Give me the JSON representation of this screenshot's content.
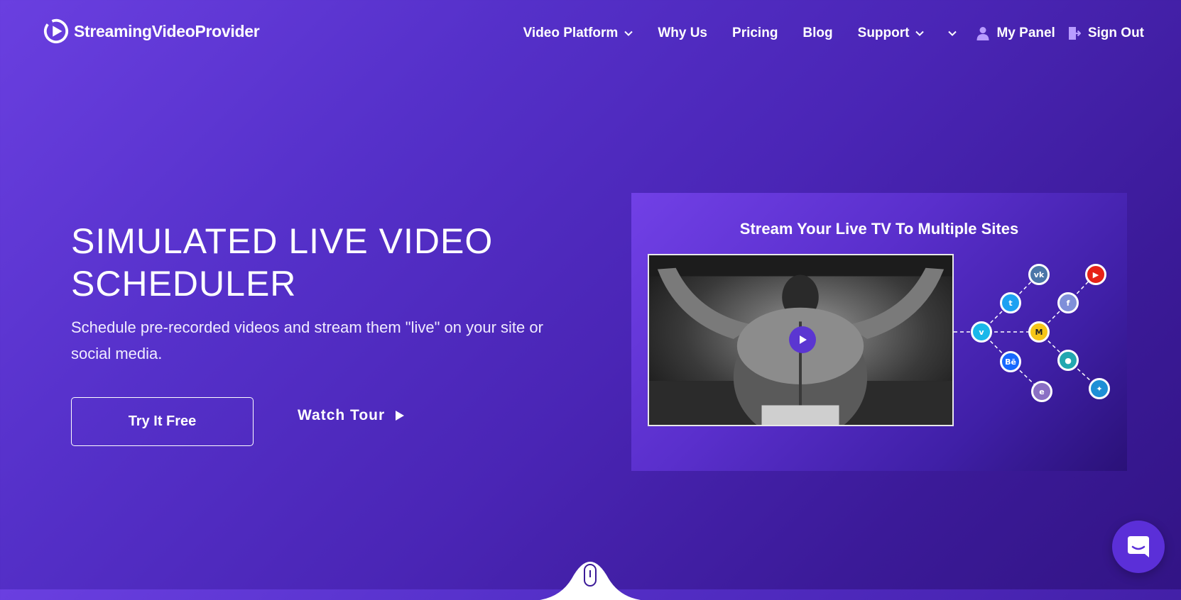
{
  "header": {
    "logo_text": "StreamingVideoProvider",
    "nav": {
      "video_platform": "Video Platform",
      "why_us": "Why Us",
      "pricing": "Pricing",
      "blog": "Blog",
      "support": "Support",
      "my_panel": "My Panel",
      "sign_out": "Sign Out"
    }
  },
  "hero": {
    "title": "SIMULATED LIVE VIDEO SCHEDULER",
    "subtitle": "Schedule pre-recorded videos and stream them \"live\" on your site or social media.",
    "try_button": "Try It Free",
    "watch_tour": "Watch Tour"
  },
  "promo": {
    "title": "Stream Your Live TV To Multiple Sites",
    "network_icons": [
      "vimeo-icon",
      "twitter-icon",
      "vk-icon",
      "behance-icon",
      "mixer-icon",
      "facebook-icon",
      "youtube-icon",
      "edge-icon",
      "map-pin-icon",
      "generic-app-icon"
    ]
  },
  "colors": {
    "background_start": "#6a3fe0",
    "background_end": "#321485",
    "chat_button": "#5b2fd8",
    "play_button": "#5b36d1"
  }
}
